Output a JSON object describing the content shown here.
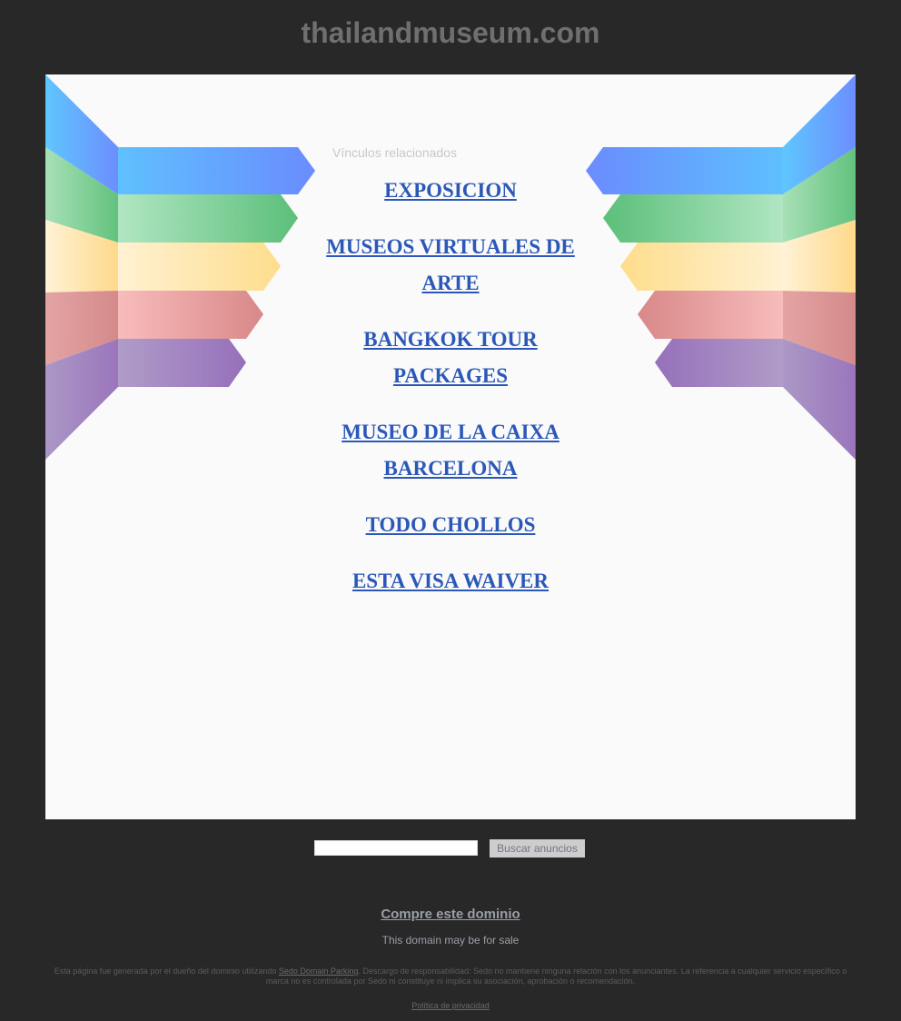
{
  "header": {
    "domain_title": "thailandmuseum.com"
  },
  "main": {
    "related_label": "Vínculos relacionados",
    "links": [
      "EXPOSICION",
      "MUSEOS VIRTUALES DE ARTE",
      "BANGKOK TOUR PACKAGES",
      "MUSEO DE LA CAIXA BARCELONA",
      "TODO CHOLLOS",
      "ESTA VISA WAIVER"
    ]
  },
  "search": {
    "value": "",
    "button_label": "Buscar anuncios"
  },
  "footer": {
    "buy_domain_label": "Compre este dominio",
    "sale_text": "This domain may be for sale",
    "disclaimer_before": "Esta página fue generada por el dueño del dominio utilizando ",
    "disclaimer_link": "Sedo Domain Parking",
    "disclaimer_after": ". Descargo de responsabilidad: Sedo no mantiene ninguna relación con los anunciantes. La referencia a cualquier servicio específico o marca no es controlada por Sedo ni constituye ni implica su asociación, aprobación o recomendación.",
    "privacy_label": "Política de privacidad"
  },
  "colors": {
    "page_background": "#282828",
    "panel_background": "#fafafa",
    "link_color": "#2b58b8",
    "ribbon_blue": "#6a98fe",
    "ribbon_green": "#5ec07c",
    "ribbon_yellow": "#fedd8a",
    "ribbon_red": "#e08a8a",
    "ribbon_purple": "#9872bd"
  }
}
